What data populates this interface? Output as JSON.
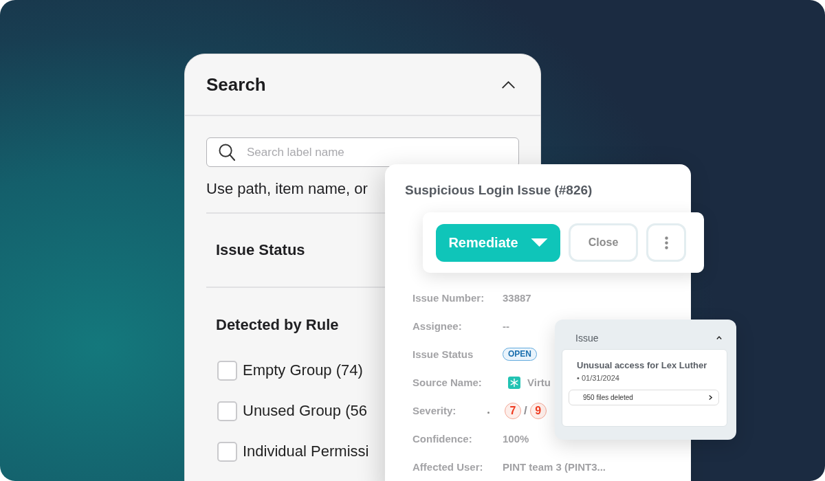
{
  "search_panel": {
    "title": "Search",
    "expanded": true,
    "search_field": {
      "placeholder": "Search label name"
    },
    "hint": "Use path, item name, or",
    "sections": [
      {
        "title": "Issue Status"
      },
      {
        "title": "Detected by Rule",
        "options": [
          {
            "label": "Empty Group (74)",
            "checked": false
          },
          {
            "label": "Unused Group (56",
            "checked": false
          },
          {
            "label": "Individual Permissi",
            "checked": false
          }
        ]
      }
    ]
  },
  "issue_card": {
    "title": "Suspicious Login Issue (#826)",
    "actions": [
      {
        "kind": "primary",
        "label": "Remediate"
      },
      {
        "kind": "secondary",
        "label": "Close"
      },
      {
        "kind": "more"
      }
    ],
    "details": [
      {
        "label": "Issue Number:",
        "kind": "text",
        "value": "33887"
      },
      {
        "label": "Assignee:",
        "kind": "text",
        "value": "--"
      },
      {
        "label": "Issue Status",
        "kind": "status",
        "value": "OPEN"
      },
      {
        "label": "Source Name:",
        "kind": "source",
        "value": "Virtu"
      },
      {
        "label": "Severity:",
        "kind": "scores",
        "values": [
          "7",
          "9"
        ],
        "separator": "/"
      },
      {
        "label": "Confidence:",
        "kind": "text",
        "value": "100%"
      },
      {
        "label": "Affected User:",
        "kind": "text",
        "value": "PINT team 3 (PINT3..."
      }
    ]
  },
  "issue_popup": {
    "title": "Issue",
    "expanded": true,
    "entry": {
      "title": "Unusual access for Lex Luther",
      "date": "• 01/31/2024",
      "detail": "950 files deleted"
    }
  }
}
